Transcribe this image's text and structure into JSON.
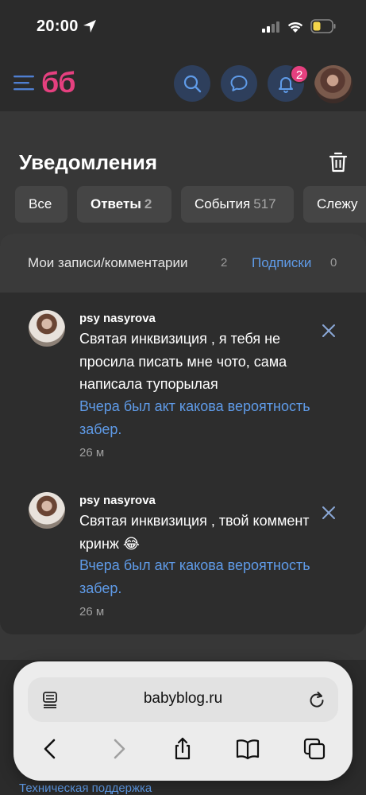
{
  "status_bar": {
    "time": "20:00"
  },
  "header": {
    "logo": "бб",
    "bell_badge": "2"
  },
  "page": {
    "title": "Уведомления"
  },
  "filter_tabs": [
    {
      "label": "Все",
      "count": ""
    },
    {
      "label": "Ответы",
      "count": "2"
    },
    {
      "label": "События",
      "count": "517"
    },
    {
      "label": "Слежу",
      "count": ""
    }
  ],
  "subtabs": {
    "mine_label": "Мои записи/комментарии",
    "mine_count": "2",
    "subscriptions_label": "Подписки",
    "subscriptions_count": "0"
  },
  "notifications": [
    {
      "author": "psy nasyrova",
      "text": "Святая инквизиция , я тебя не просила писать мне чото, сама написала тупорылая",
      "link": "Вчера был акт какова вероятность забер.",
      "time": "26 м"
    },
    {
      "author": "psy nasyrova",
      "text": "Святая инквизиция , твой коммент кринж 😂",
      "link": "Вчера был акт какова вероятность забер.",
      "time": "26 м"
    }
  ],
  "safari": {
    "url": "babyblog.ru"
  },
  "footer": {
    "support_link": "Техническая поддержка"
  },
  "colors": {
    "accent_pink": "#e5407f",
    "link_blue": "#5f9be8",
    "background": "#373737"
  }
}
